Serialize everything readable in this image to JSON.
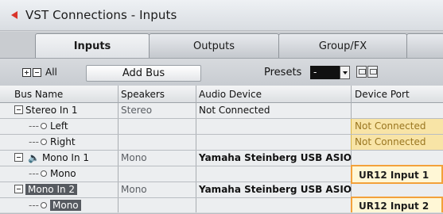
{
  "window": {
    "title": "VST Connections - Inputs"
  },
  "tabs": [
    {
      "label": "Inputs"
    },
    {
      "label": "Outputs"
    },
    {
      "label": "Group/FX"
    }
  ],
  "toolbar": {
    "all_label": "All",
    "add_bus": "Add Bus",
    "presets_label": "Presets",
    "presets_value": "-"
  },
  "table": {
    "headers": [
      "Bus Name",
      "Speakers",
      "Audio Device",
      "Device Port"
    ],
    "rows": [
      {
        "bus": "Stereo In 1",
        "speakers": "Stereo",
        "device": "Not Connected",
        "port": ""
      },
      {
        "bus": "Left",
        "speakers": "",
        "device": "",
        "port": "Not Connected"
      },
      {
        "bus": "Right",
        "speakers": "",
        "device": "",
        "port": "Not Connected"
      },
      {
        "bus": "Mono In 1",
        "speakers": "Mono",
        "device": "Yamaha Steinberg USB ASIO",
        "port": ""
      },
      {
        "bus": "Mono",
        "speakers": "",
        "device": "",
        "port": "UR12 Input 1"
      },
      {
        "bus": "Mono In 2",
        "speakers": "Mono",
        "device": "Yamaha Steinberg USB ASIO",
        "port": ""
      },
      {
        "bus": "Mono",
        "speakers": "",
        "device": "",
        "port": "UR12 Input 2"
      }
    ]
  },
  "colors": {
    "accent": "#f3a13a",
    "highlight": "#f8e4a6",
    "title_icon": "#d9342b"
  }
}
